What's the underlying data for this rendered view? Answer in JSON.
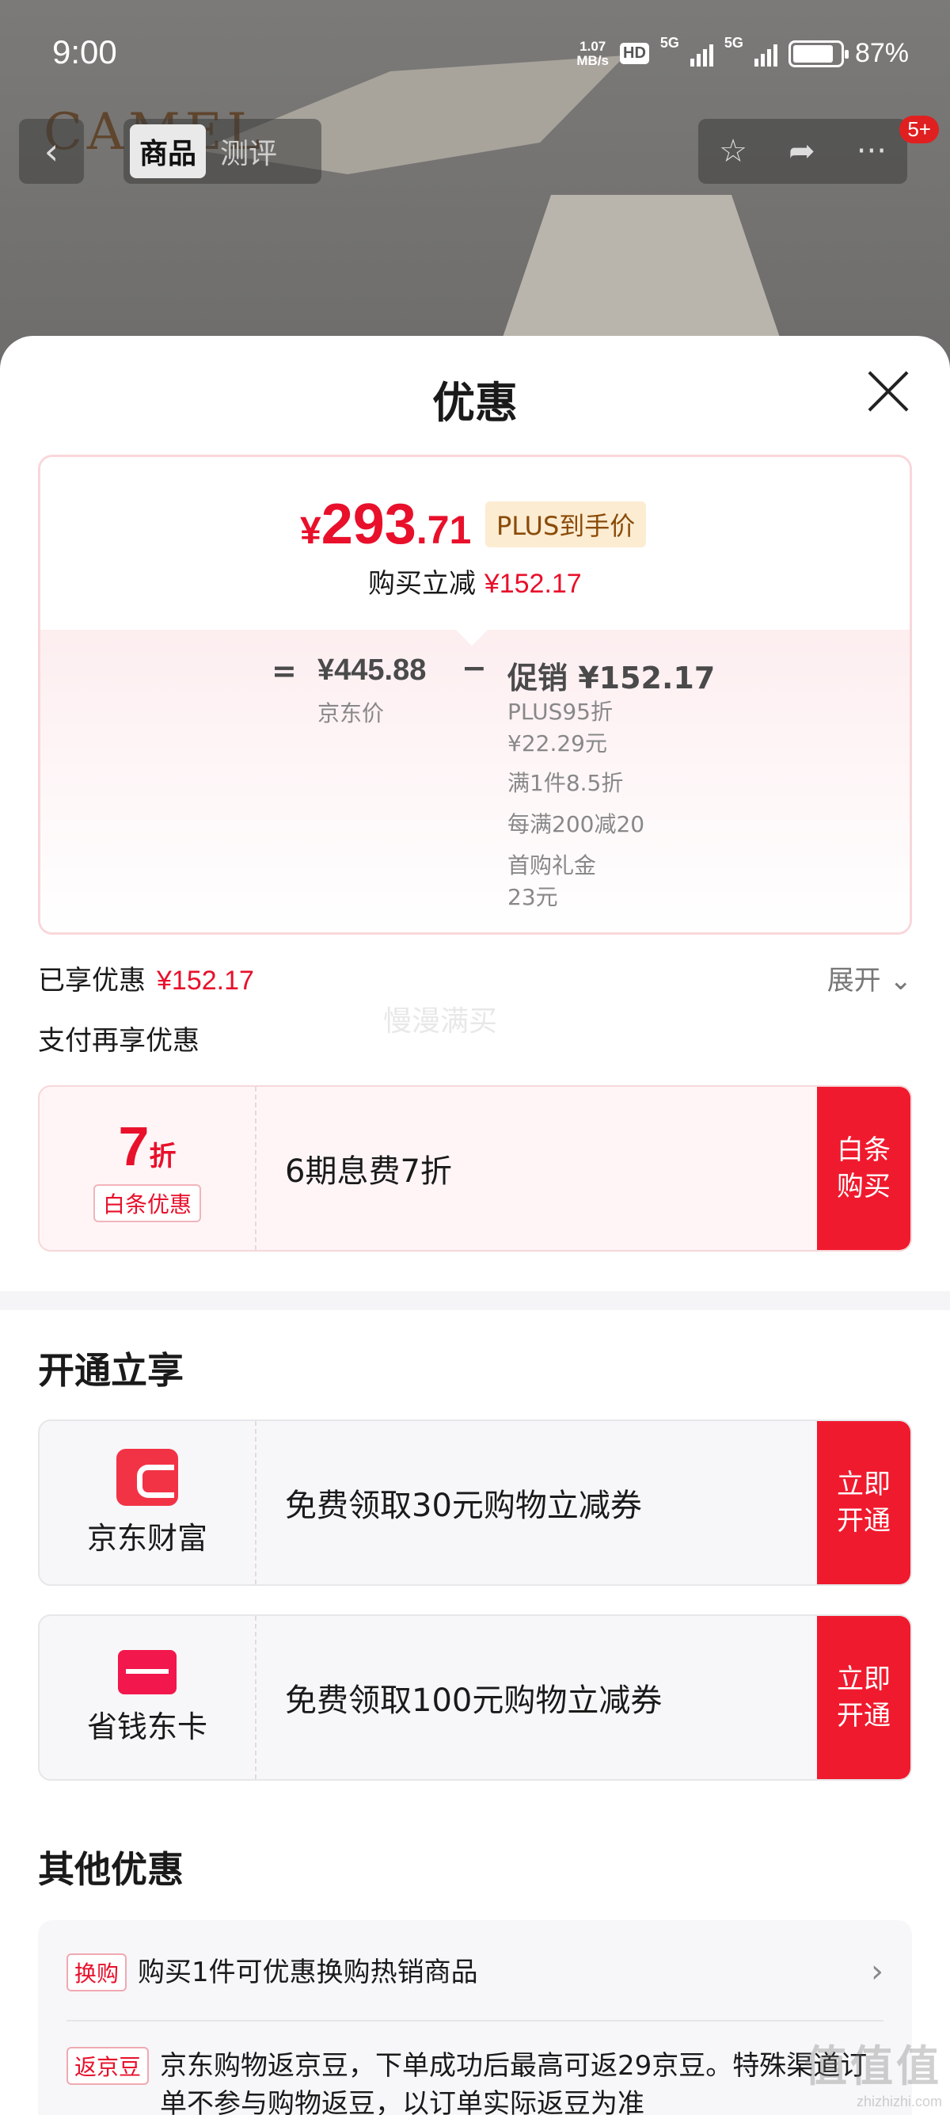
{
  "status_bar": {
    "time": "9:00",
    "speed_value": "1.07",
    "speed_unit": "MB/s",
    "hd": "HD",
    "net1": "5G",
    "net2": "5G",
    "battery_percent": "87%",
    "battery_level": 0.87
  },
  "background": {
    "brand_logo": "CAMEL"
  },
  "nav": {
    "back_icon": "back-arrow-icon",
    "tabs": [
      {
        "label": "商品",
        "active": true
      },
      {
        "label": "测评",
        "active": false
      }
    ],
    "actions": [
      "star-icon",
      "share-icon",
      "more-icon"
    ],
    "badge": "5+"
  },
  "sheet": {
    "title": "优惠",
    "price_card": {
      "price_symbol": "¥",
      "price_int": "293",
      "price_dec": ".71",
      "plus_tag": "PLUS到手价",
      "save_label": "购买立减",
      "save_amount": "¥152.17",
      "equals": "=",
      "jd_price": "¥445.88",
      "jd_label": "京东价",
      "minus": "−",
      "promo_label": "促销 ¥152.17",
      "promo_items": [
        "PLUS95折",
        "¥22.29元",
        "满1件8.5折",
        "每满200减20",
        "首购礼金",
        "23元"
      ]
    },
    "enjoyed_label": "已享优惠",
    "enjoyed_amount": "¥152.17",
    "expand_label": "展开",
    "watermark": "慢漫满买",
    "pay_more_label": "支付再享优惠",
    "baitiao": {
      "discount_num": "7",
      "discount_unit": "折",
      "tag": "白条优惠",
      "desc": "6期息费7折",
      "button": "白条\n购买"
    },
    "open_section": {
      "title": "开通立享",
      "items": [
        {
          "icon": "wallet-icon",
          "name": "京东财富",
          "desc": "免费领取30元购物立减券",
          "button": "立即\n开通"
        },
        {
          "icon": "card-icon",
          "name": "省钱东卡",
          "desc": "免费领取100元购物立减券",
          "button": "立即\n开通"
        }
      ]
    },
    "other_section": {
      "title": "其他优惠",
      "rows": [
        {
          "tag": "换购",
          "text": "购买1件可优惠换购热销商品"
        },
        {
          "tag": "返京豆",
          "text": "京东购物返京豆，下单成功后最高可返29京豆。特殊渠道订单不参与购物返豆，以订单实际返豆为准"
        }
      ]
    }
  },
  "corner_watermark": {
    "logo": "值值值",
    "url": "zhizhizhi.com"
  },
  "colors": {
    "accent": "#e8102b",
    "button": "#f01a2e",
    "plus_bg": "#fcecd2"
  }
}
